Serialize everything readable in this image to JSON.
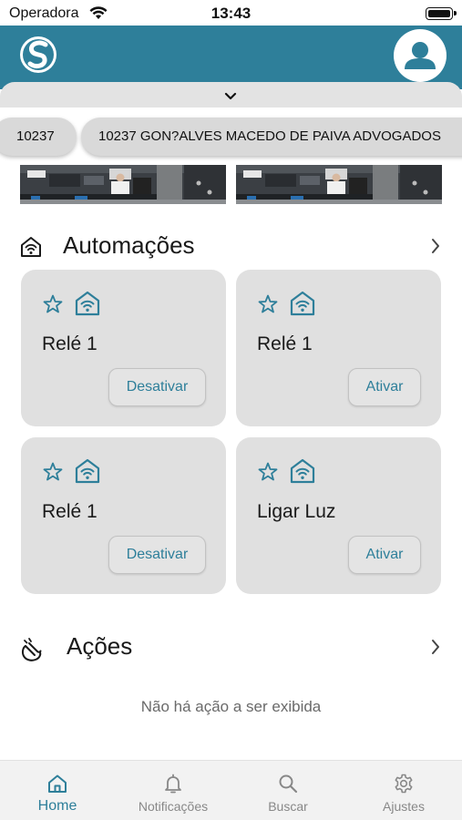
{
  "status_bar": {
    "carrier": "Operadora",
    "time": "13:43"
  },
  "header": {
    "logo_icon": "app-logo-icon",
    "profile_icon": "user-icon"
  },
  "location_chips": [
    {
      "label": "10237"
    },
    {
      "label": "10237 GON?ALVES MACEDO DE PAIVA ADVOGADOS"
    }
  ],
  "automations": {
    "title": "Automações",
    "cards": [
      {
        "title": "Relé 1",
        "button": "Desativar"
      },
      {
        "title": "Relé 1",
        "button": "Ativar"
      },
      {
        "title": "Relé 1",
        "button": "Desativar"
      },
      {
        "title": "Ligar Luz",
        "button": "Ativar"
      }
    ]
  },
  "actions": {
    "title": "Ações",
    "empty_message": "Não há ação a ser exibida"
  },
  "tabs": [
    {
      "label": "Home",
      "icon": "home-icon",
      "active": true
    },
    {
      "label": "Notificações",
      "icon": "bell-icon",
      "active": false
    },
    {
      "label": "Buscar",
      "icon": "search-icon",
      "active": false
    },
    {
      "label": "Ajustes",
      "icon": "gear-icon",
      "active": false
    }
  ],
  "colors": {
    "primary": "#2e7f9a",
    "card_bg": "#e0e0e0",
    "inactive_tab": "#888888"
  }
}
